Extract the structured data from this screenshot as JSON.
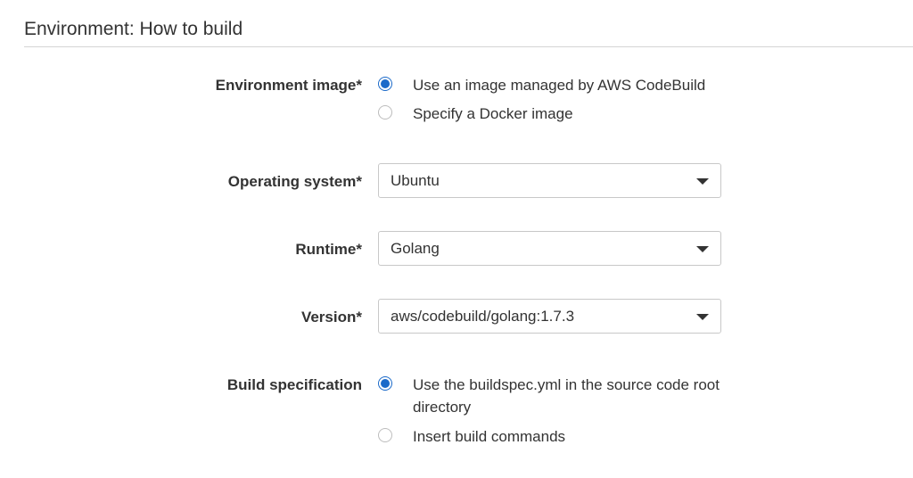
{
  "section": {
    "title": "Environment: How to build"
  },
  "environment_image": {
    "label": "Environment image*",
    "options": [
      {
        "label": "Use an image managed by AWS CodeBuild",
        "selected": true
      },
      {
        "label": "Specify a Docker image",
        "selected": false
      }
    ]
  },
  "operating_system": {
    "label": "Operating system*",
    "value": "Ubuntu"
  },
  "runtime": {
    "label": "Runtime*",
    "value": "Golang"
  },
  "version": {
    "label": "Version*",
    "value": "aws/codebuild/golang:1.7.3"
  },
  "build_specification": {
    "label": "Build specification",
    "options": [
      {
        "label": "Use the buildspec.yml in the source code root directory",
        "selected": true
      },
      {
        "label": "Insert build commands",
        "selected": false
      }
    ]
  },
  "colors": {
    "accent": "#1b6ac9",
    "text": "#333333",
    "border": "#c8c8c8"
  },
  "icons": {
    "dropdown": "chevron-down-icon",
    "radio_selected": "radio-selected-icon",
    "radio_unselected": "radio-unselected-icon"
  }
}
